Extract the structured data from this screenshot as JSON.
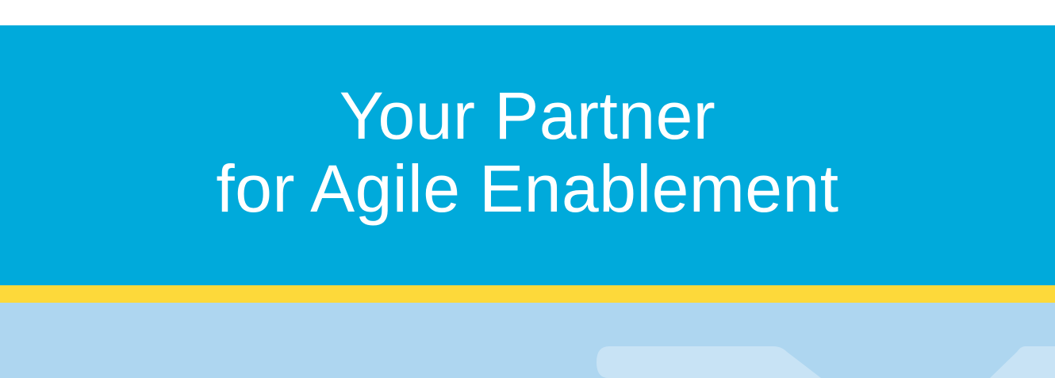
{
  "hero": {
    "title_line1": "Your Partner",
    "title_line2": "for Agile Enablement"
  },
  "colors": {
    "hero_background": "#00aadb",
    "accent_stripe": "#fdd93a",
    "lower_band": "#aed6f0",
    "decoration": "#c8e3f5",
    "title_text": "#ffffff"
  }
}
